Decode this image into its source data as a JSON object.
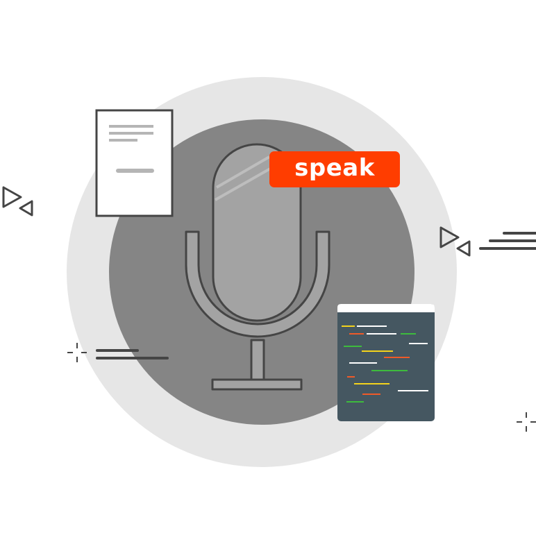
{
  "speak_badge": {
    "label": "speak",
    "background": "#ff3d00",
    "text_color": "#ffffff"
  },
  "colors": {
    "outer_circle": "#e6e6e6",
    "inner_circle": "#858585",
    "microphone_fill": "#a3a3a3",
    "outline": "#454545",
    "document_fill": "#ffffff",
    "document_lines": "#b5b5b5",
    "code_panel": "#455761",
    "code_yellow": "#f4d31c",
    "code_orange": "#f05a28",
    "code_green": "#3dbb3d",
    "code_white": "#ffffff"
  },
  "icons": [
    "microphone-icon",
    "document-icon",
    "code-window-icon",
    "play-triangles-icon",
    "sparkle-cross-icon",
    "motion-lines-icon"
  ]
}
